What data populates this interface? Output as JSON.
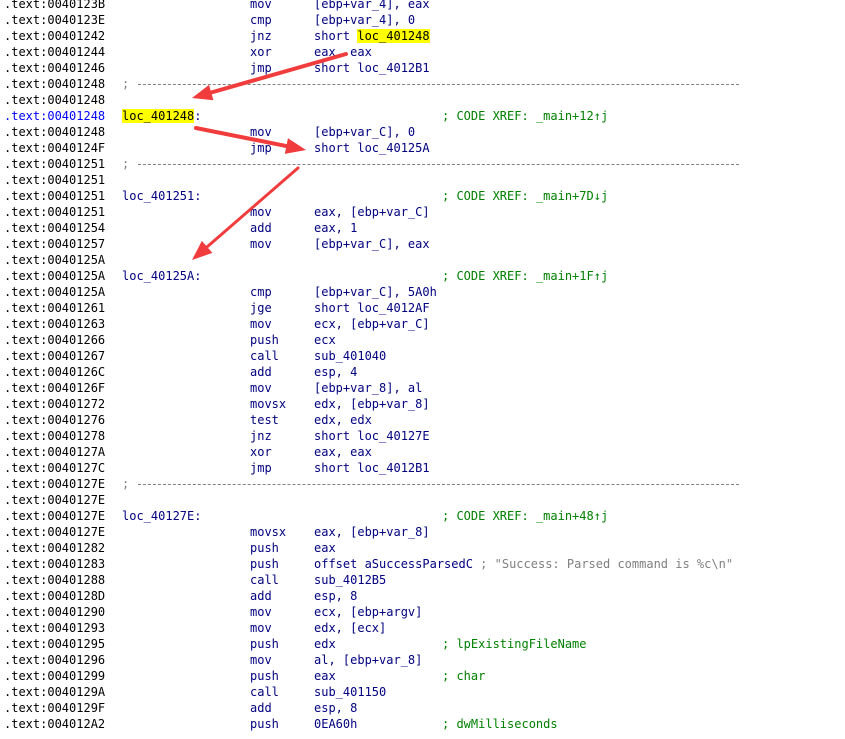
{
  "lines": [
    {
      "addr": ".text:0040123B",
      "mn": "mov",
      "op": "[ebp+var_4], eax"
    },
    {
      "addr": ".text:0040123E",
      "mn": "cmp",
      "op": "[ebp+var_4], 0"
    },
    {
      "addr": ".text:00401242",
      "mn": "jnz",
      "op": "short ",
      "op_hl": "loc_401248"
    },
    {
      "addr": ".text:00401244",
      "mn": "xor",
      "op": "eax, eax"
    },
    {
      "addr": ".text:00401246",
      "mn": "jmp",
      "op": "short loc_4012B1"
    },
    {
      "addr": ".text:00401248",
      "sep": true
    },
    {
      "addr": ".text:00401248"
    },
    {
      "addr": ".text:00401248",
      "cur": true,
      "label_hl": "loc_401248",
      "label_suffix": ":",
      "cmt": "; CODE XREF: _main+12↑j"
    },
    {
      "addr": ".text:00401248",
      "mn": "mov",
      "op": "[ebp+var_C], 0"
    },
    {
      "addr": ".text:0040124F",
      "mn": "jmp",
      "op": "short loc_40125A"
    },
    {
      "addr": ".text:00401251",
      "sep": true
    },
    {
      "addr": ".text:00401251"
    },
    {
      "addr": ".text:00401251",
      "label": "loc_401251:",
      "cmt": "; CODE XREF: _main+7D↓j"
    },
    {
      "addr": ".text:00401251",
      "mn": "mov",
      "op": "eax, [ebp+var_C]"
    },
    {
      "addr": ".text:00401254",
      "mn": "add",
      "op": "eax, 1"
    },
    {
      "addr": ".text:00401257",
      "mn": "mov",
      "op": "[ebp+var_C], eax"
    },
    {
      "addr": ".text:0040125A"
    },
    {
      "addr": ".text:0040125A",
      "label": "loc_40125A:",
      "cmt": "; CODE XREF: _main+1F↑j"
    },
    {
      "addr": ".text:0040125A",
      "mn": "cmp",
      "op": "[ebp+var_C], 5A0h"
    },
    {
      "addr": ".text:00401261",
      "mn": "jge",
      "op": "short loc_4012AF"
    },
    {
      "addr": ".text:00401263",
      "mn": "mov",
      "op": "ecx, [ebp+var_C]"
    },
    {
      "addr": ".text:00401266",
      "mn": "push",
      "op": "ecx"
    },
    {
      "addr": ".text:00401267",
      "mn": "call",
      "op": "sub_401040"
    },
    {
      "addr": ".text:0040126C",
      "mn": "add",
      "op": "esp, 4"
    },
    {
      "addr": ".text:0040126F",
      "mn": "mov",
      "op": "[ebp+var_8], al"
    },
    {
      "addr": ".text:00401272",
      "mn": "movsx",
      "op": "edx, [ebp+var_8]"
    },
    {
      "addr": ".text:00401276",
      "mn": "test",
      "op": "edx, edx"
    },
    {
      "addr": ".text:00401278",
      "mn": "jnz",
      "op": "short loc_40127E"
    },
    {
      "addr": ".text:0040127A",
      "mn": "xor",
      "op": "eax, eax"
    },
    {
      "addr": ".text:0040127C",
      "mn": "jmp",
      "op": "short loc_4012B1"
    },
    {
      "addr": ".text:0040127E",
      "sep": true
    },
    {
      "addr": ".text:0040127E"
    },
    {
      "addr": ".text:0040127E",
      "label": "loc_40127E:",
      "cmt": "; CODE XREF: _main+48↑j"
    },
    {
      "addr": ".text:0040127E",
      "mn": "movsx",
      "op": "eax, [ebp+var_8]"
    },
    {
      "addr": ".text:00401282",
      "mn": "push",
      "op": "eax"
    },
    {
      "addr": ".text:00401283",
      "mn": "push",
      "op": "offset aSuccessParsedC",
      "strc": " ; \"Success: Parsed command is %c\\n\""
    },
    {
      "addr": ".text:00401288",
      "mn": "call",
      "op": "sub_4012B5"
    },
    {
      "addr": ".text:0040128D",
      "mn": "add",
      "op": "esp, 8"
    },
    {
      "addr": ".text:00401290",
      "mn": "mov",
      "op": "ecx, [ebp+argv]"
    },
    {
      "addr": ".text:00401293",
      "mn": "mov",
      "op": "edx, [ecx]"
    },
    {
      "addr": ".text:00401295",
      "mn": "push",
      "op": "edx",
      "cmt": "; lpExistingFileName"
    },
    {
      "addr": ".text:00401296",
      "mn": "mov",
      "op": "al, [ebp+var_8]"
    },
    {
      "addr": ".text:00401299",
      "mn": "push",
      "op": "eax",
      "cmt": "; char"
    },
    {
      "addr": ".text:0040129A",
      "mn": "call",
      "op": "sub_401150"
    },
    {
      "addr": ".text:0040129F",
      "mn": "add",
      "op": "esp, 8"
    },
    {
      "addr": ".text:004012A2",
      "mn": "push",
      "op": "0EA60h",
      "cmt": "; dwMilliseconds"
    }
  ],
  "colors": {
    "address": "#000000",
    "current_address": "#0000ff",
    "code": "#000080",
    "comment": "#008000",
    "highlight": "#ffff00",
    "arrow": "#f03c3c"
  },
  "arrows": [
    {
      "name": "arrow-jnz-to-loc-401248",
      "from_line": 3,
      "to_line": 6
    },
    {
      "name": "arrow-mov-to-jmp-target",
      "from_line": 8,
      "to_line": 9
    },
    {
      "name": "arrow-to-loc-40125A",
      "from_line": 10,
      "to_line": 17
    }
  ]
}
